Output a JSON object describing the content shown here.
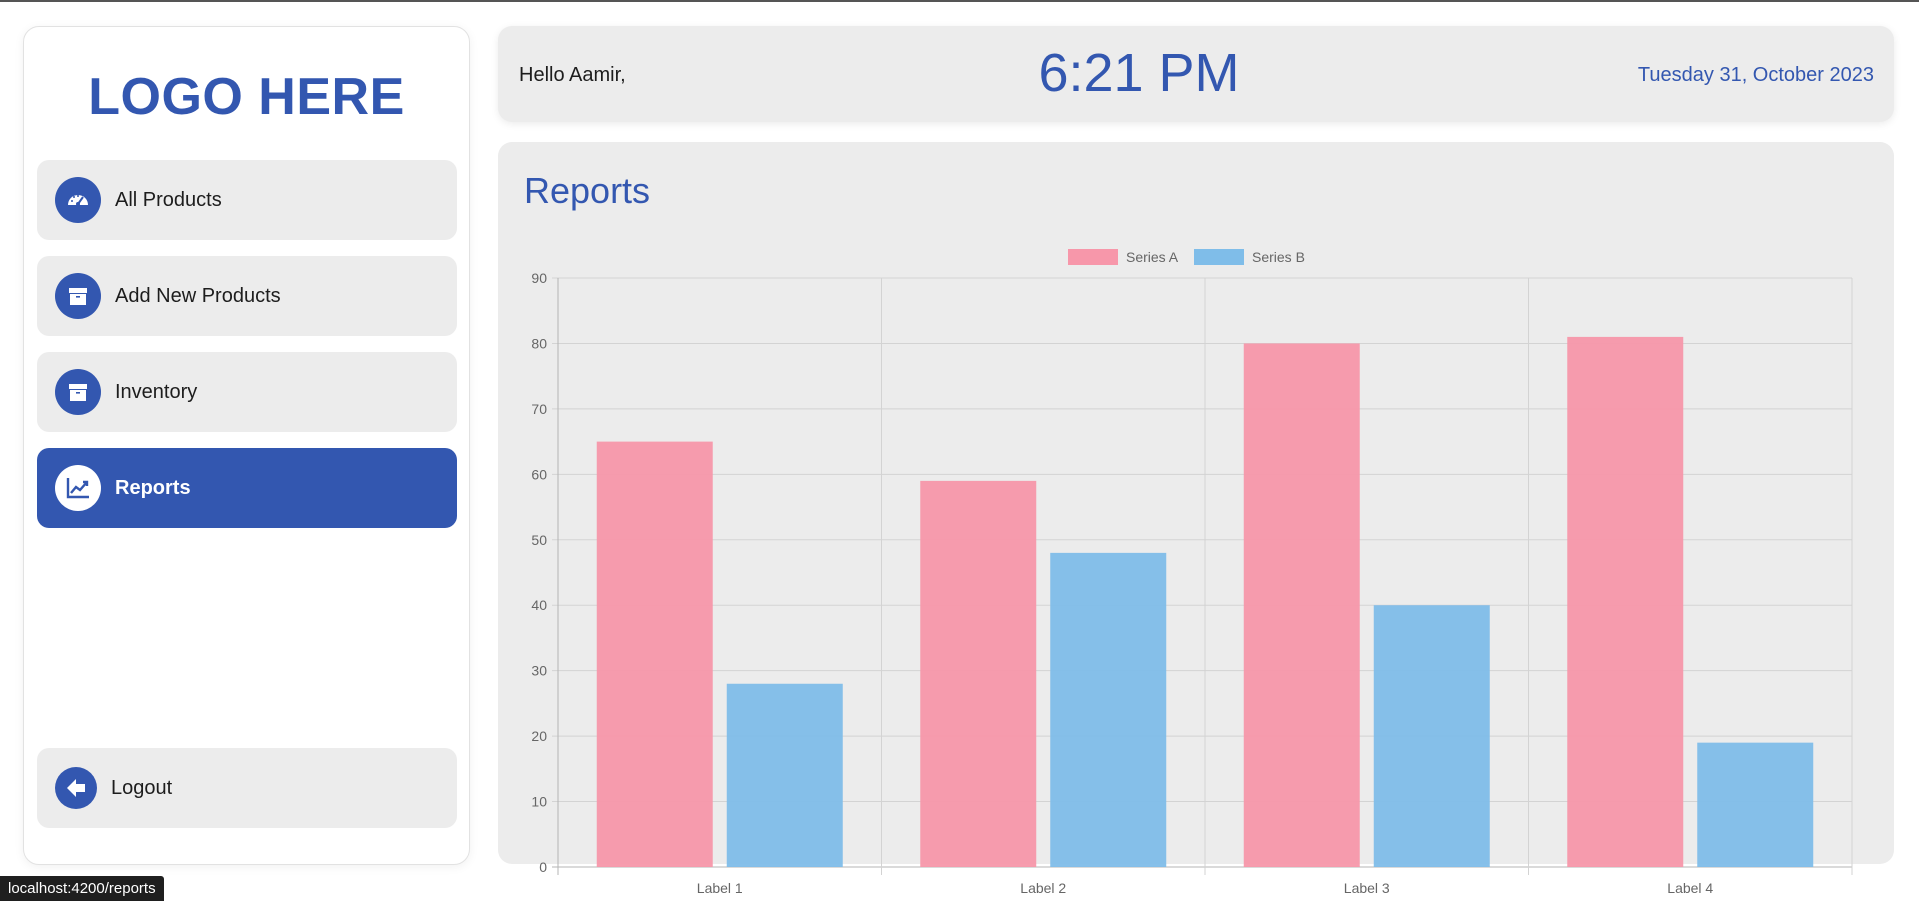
{
  "sidebar": {
    "logo": "LOGO HERE",
    "items": [
      {
        "label": "All Products",
        "icon": "speedometer-icon",
        "active": false
      },
      {
        "label": "Add New Products",
        "icon": "archive-box-icon",
        "active": false
      },
      {
        "label": "Inventory",
        "icon": "archive-box-icon",
        "active": false
      },
      {
        "label": "Reports",
        "icon": "chart-line-icon",
        "active": true
      }
    ],
    "logout": {
      "label": "Logout",
      "icon": "arrow-left-icon"
    }
  },
  "header": {
    "greeting": "Hello Aamir,",
    "time": "6:21 PM",
    "date": "Tuesday 31, October 2023"
  },
  "main": {
    "title": "Reports"
  },
  "status_bar": {
    "url": "localhost:4200/reports"
  },
  "colors": {
    "accent": "#3357b0",
    "panel_bg": "#ececec",
    "series_a": "#f797aa",
    "series_b": "#7fbde9"
  },
  "chart_data": {
    "type": "bar",
    "categories": [
      "Label 1",
      "Label 2",
      "Label 3",
      "Label 4"
    ],
    "series": [
      {
        "name": "Series A",
        "values": [
          65,
          59,
          80,
          81
        ]
      },
      {
        "name": "Series B",
        "values": [
          28,
          48,
          40,
          19
        ]
      }
    ],
    "ylim": [
      0,
      90
    ],
    "yticks": [
      0,
      10,
      20,
      30,
      40,
      50,
      60,
      70,
      80,
      90
    ],
    "grid": true,
    "legend": "top-center"
  }
}
